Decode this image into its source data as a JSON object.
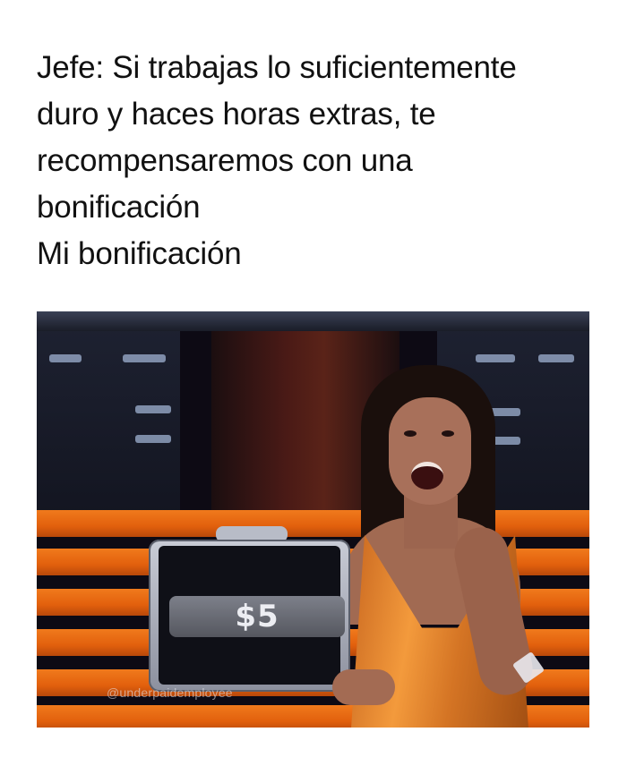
{
  "caption": {
    "lines": [
      "Jefe: Si trabajas lo suficientemente",
      "duro y haces horas extras, te",
      "recompensaremos con una",
      "bonificación",
      "Mi bonificación"
    ]
  },
  "image": {
    "amount": "$5",
    "watermark": "@underpaidemployee",
    "colors": {
      "stripe": "#e8660f",
      "dress": "#f39a3c",
      "background": "#0d0a14"
    }
  }
}
